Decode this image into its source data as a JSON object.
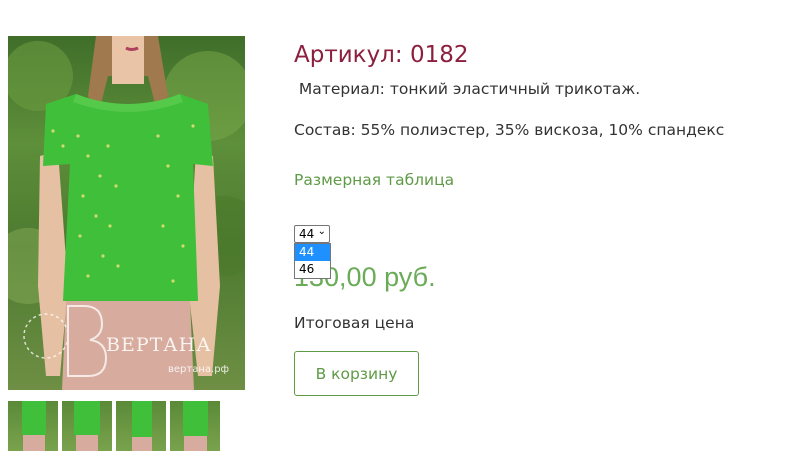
{
  "product": {
    "title": "Артикул: 0182",
    "material": " Материал: тонкий эластичный трикотаж.",
    "composition": "Состав: 55% полиэстер, 35% вискоза, 10% спандекс",
    "size_table_link": "Размерная таблица",
    "price": "130,00 руб.",
    "final_price_label": "Итоговая цена",
    "cart_button": "В корзину"
  },
  "size_select": {
    "selected": "44",
    "options": [
      "44",
      "46"
    ],
    "highlighted_index": 0
  },
  "photo": {
    "watermark_brand": "ВЕРТАНА",
    "watermark_site": "вертана.рф"
  },
  "thumbnails_count": 4,
  "colors": {
    "title": "#8c1f3e",
    "accent_green": "#5f9a46",
    "price_green": "#6aab58",
    "blouse_green": "#3fbf3a"
  }
}
